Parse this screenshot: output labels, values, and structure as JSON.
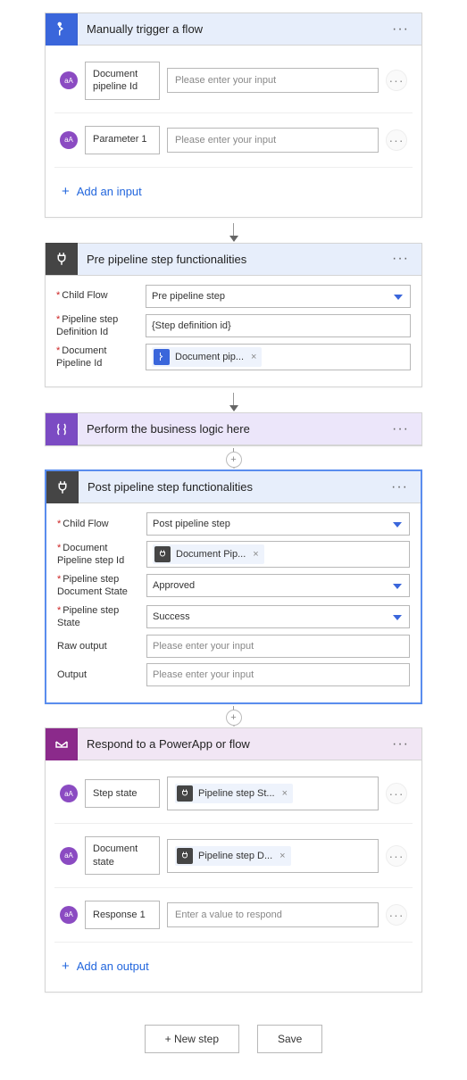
{
  "trigger": {
    "title": "Manually trigger a flow",
    "params": [
      {
        "label": "Document pipeline Id",
        "placeholder": "Please enter your input"
      },
      {
        "label": "Parameter 1",
        "placeholder": "Please enter your input"
      }
    ],
    "add_input": "Add an input"
  },
  "pre": {
    "title": "Pre pipeline step functionalities",
    "rows": {
      "child_flow": {
        "label": "Child Flow",
        "value": "Pre pipeline step"
      },
      "def_id": {
        "label": "Pipeline step Definition Id",
        "value": "{Step definition id}"
      },
      "pipeline_id": {
        "label": "Document Pipeline Id",
        "token": "Document pip..."
      }
    }
  },
  "biz": {
    "title": "Perform the business logic here"
  },
  "post": {
    "title": "Post pipeline step functionalities",
    "rows": {
      "child_flow": {
        "label": "Child Flow",
        "value": "Post pipeline step"
      },
      "pipeline_step_id": {
        "label": "Document Pipeline step Id",
        "token": "Document Pip..."
      },
      "doc_state": {
        "label": "Pipeline step Document State",
        "value": "Approved"
      },
      "step_state": {
        "label": "Pipeline step State",
        "value": "Success"
      },
      "raw_output": {
        "label": "Raw output",
        "placeholder": "Please enter your input"
      },
      "output": {
        "label": "Output",
        "placeholder": "Please enter your input"
      }
    }
  },
  "respond": {
    "title": "Respond to a PowerApp or flow",
    "params": [
      {
        "label": "Step state",
        "token": "Pipeline step St..."
      },
      {
        "label": "Document state",
        "token": "Pipeline step D..."
      },
      {
        "label": "Response 1",
        "placeholder": "Enter a value to respond"
      }
    ],
    "add_output": "Add an output"
  },
  "footer": {
    "new_step": "+ New step",
    "save": "Save"
  },
  "glyphs": {
    "avatar": "aA",
    "plus": "+",
    "close": "×",
    "menu": "···"
  }
}
